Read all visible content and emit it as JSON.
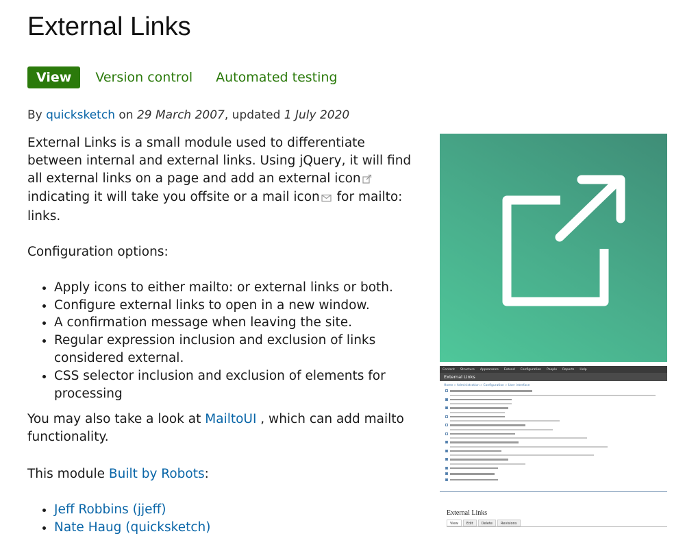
{
  "page": {
    "title": "External Links"
  },
  "tabs": [
    {
      "label": "View",
      "active": true
    },
    {
      "label": "Version control",
      "active": false
    },
    {
      "label": "Automated testing",
      "active": false
    }
  ],
  "byline": {
    "prefix": "By",
    "author": "quicksketch",
    "on": "on",
    "created": "29 March 2007",
    "updated_prefix": ", updated",
    "updated": "1 July 2020"
  },
  "content": {
    "intro_part1": "External Links is a small module used to differentiate between internal and external links. Using jQuery, it will find all external links on a page and add an external icon",
    "intro_part2": "indicating it will take you offsite or a mail icon",
    "intro_part3": "for mailto: links.",
    "config_heading": "Configuration options:",
    "options": [
      "Apply icons to either mailto: or external links or both.",
      "Configure external links to open in a new window.",
      "A confirmation message when leaving the site.",
      "Regular expression inclusion and exclusion of links considered external.",
      "CSS selector inclusion and exclusion of elements for processing"
    ],
    "mailtoui_prefix": "You may also take a look at",
    "mailtoui_link": "MailtoUI",
    "mailtoui_suffix": ", which can add mailto functionality.",
    "robots_prefix": "This module",
    "robots_link": "Built by Robots",
    "robots_suffix": ":",
    "people": [
      "Jeff Robbins (jjeff)",
      "Nate Haug (quicksketch)"
    ]
  },
  "sidebar": {
    "hero_icon": "external-link-icon",
    "hero_colors": [
      "#3f8d77",
      "#4fc79a"
    ],
    "screenshot1": {
      "title": "External Links",
      "toolbar": [
        "Content",
        "Structure",
        "Appearance",
        "Extend",
        "Configuration",
        "People",
        "Reports",
        "Help"
      ],
      "breadcrumb": "Home » Administration » Configuration » User interface"
    },
    "screenshot2": {
      "title": "External Links",
      "tabs": [
        "View",
        "Edit",
        "Delete",
        "Revisions"
      ]
    }
  },
  "colors": {
    "accent_green": "#2b7a0b",
    "link_blue": "#0a66a8"
  }
}
